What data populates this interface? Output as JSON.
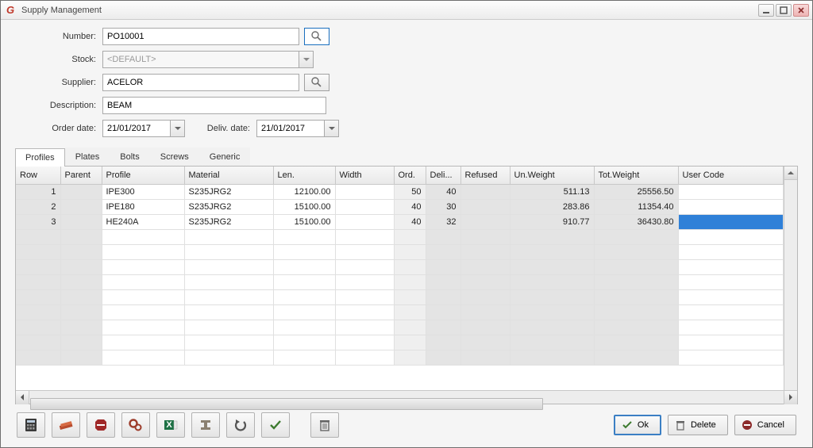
{
  "window": {
    "title": "Supply Management"
  },
  "form": {
    "number_label": "Number:",
    "number_value": "PO10001",
    "stock_label": "Stock:",
    "stock_value": "<DEFAULT>",
    "supplier_label": "Supplier:",
    "supplier_value": "ACELOR",
    "description_label": "Description:",
    "description_value": "BEAM",
    "orderdate_label": "Order date:",
    "orderdate_value": "21/01/2017",
    "delivdate_label": "Deliv. date:",
    "delivdate_value": "21/01/2017"
  },
  "tabs": {
    "profiles": "Profiles",
    "plates": "Plates",
    "bolts": "Bolts",
    "screws": "Screws",
    "generic": "Generic"
  },
  "columns": {
    "row": "Row",
    "parent": "Parent",
    "profile": "Profile",
    "material": "Material",
    "len": "Len.",
    "width": "Width",
    "ord": "Ord.",
    "deli": "Deli...",
    "refused": "Refused",
    "unweight": "Un.Weight",
    "totweight": "Tot.Weight",
    "usercode": "User Code"
  },
  "rows": [
    {
      "row": "1",
      "parent": "",
      "profile": "IPE300",
      "material": "S235JRG2",
      "len": "12100.00",
      "width": "",
      "ord": "50",
      "deli": "40",
      "refused": "",
      "unweight": "511.13",
      "totweight": "25556.50",
      "usercode": ""
    },
    {
      "row": "2",
      "parent": "",
      "profile": "IPE180",
      "material": "S235JRG2",
      "len": "15100.00",
      "width": "",
      "ord": "40",
      "deli": "30",
      "refused": "",
      "unweight": "283.86",
      "totweight": "11354.40",
      "usercode": ""
    },
    {
      "row": "3",
      "parent": "",
      "profile": "HE240A",
      "material": "S235JRG2",
      "len": "15100.00",
      "width": "",
      "ord": "40",
      "deli": "32",
      "refused": "",
      "unweight": "910.77",
      "totweight": "36430.80",
      "usercode": ""
    }
  ],
  "buttons": {
    "ok": "Ok",
    "delete": "Delete",
    "cancel": "Cancel"
  }
}
